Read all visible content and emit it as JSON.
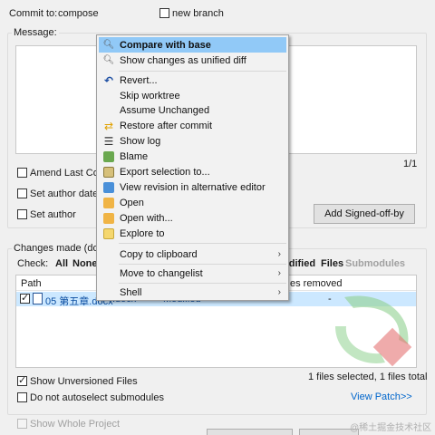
{
  "commit": {
    "label": "Commit to:",
    "branch": "compose",
    "new_branch_label": "new branch"
  },
  "message": {
    "group_label": "Message:",
    "counter": "1/1"
  },
  "options": {
    "amend_label": "Amend Last Com",
    "set_author_date_label": "Set author date",
    "set_author_label": "Set author",
    "signed_off_button": "Add Signed-off-by"
  },
  "changes": {
    "group_label": "Changes made (doub",
    "check_label": "Check:",
    "check_all": "All",
    "check_none": "None",
    "filter_modified": "odified",
    "filter_files": "Files",
    "filter_submodules": "Submodules",
    "col_path": "Path",
    "col_lines_removed": "es removed",
    "file_name": "05 第五章.docx",
    "file_ext": ".docx",
    "file_status": "Modified",
    "file_removed": "-",
    "show_unversioned_label": "Show Unversioned Files",
    "no_autoselect_label": "Do not autoselect submodules",
    "selection_status": "1 files selected, 1 files total",
    "view_patch_link": "View Patch>>",
    "show_whole_project_label": "Show Whole Project"
  },
  "watermark": "@稀土掘金技术社区",
  "menu": {
    "items": [
      {
        "label": "Compare with base",
        "icon": "magnifier-icon"
      },
      {
        "label": "Show changes as unified diff",
        "icon": "magnifier-icon"
      },
      {
        "label": "Revert...",
        "icon": "undo-icon"
      },
      {
        "label": "Skip worktree",
        "icon": ""
      },
      {
        "label": "Assume Unchanged",
        "icon": ""
      },
      {
        "label": "Restore after commit",
        "icon": "restore-icon"
      },
      {
        "label": "Show log",
        "icon": "log-icon"
      },
      {
        "label": "Blame",
        "icon": "blame-icon"
      },
      {
        "label": "Export selection to...",
        "icon": "export-icon"
      },
      {
        "label": "View revision in alternative editor",
        "icon": "editor-icon"
      },
      {
        "label": "Open",
        "icon": "folder-icon"
      },
      {
        "label": "Open with...",
        "icon": "folder-icon"
      },
      {
        "label": "Explore to",
        "icon": "explorer-icon"
      },
      {
        "label": "Copy to clipboard",
        "icon": ""
      },
      {
        "label": "Move to changelist",
        "icon": ""
      },
      {
        "label": "Shell",
        "icon": ""
      }
    ]
  },
  "colors": {
    "menu_highlight": "#91c9f7",
    "link": "#0066cc",
    "row_selected": "#cce8ff"
  }
}
